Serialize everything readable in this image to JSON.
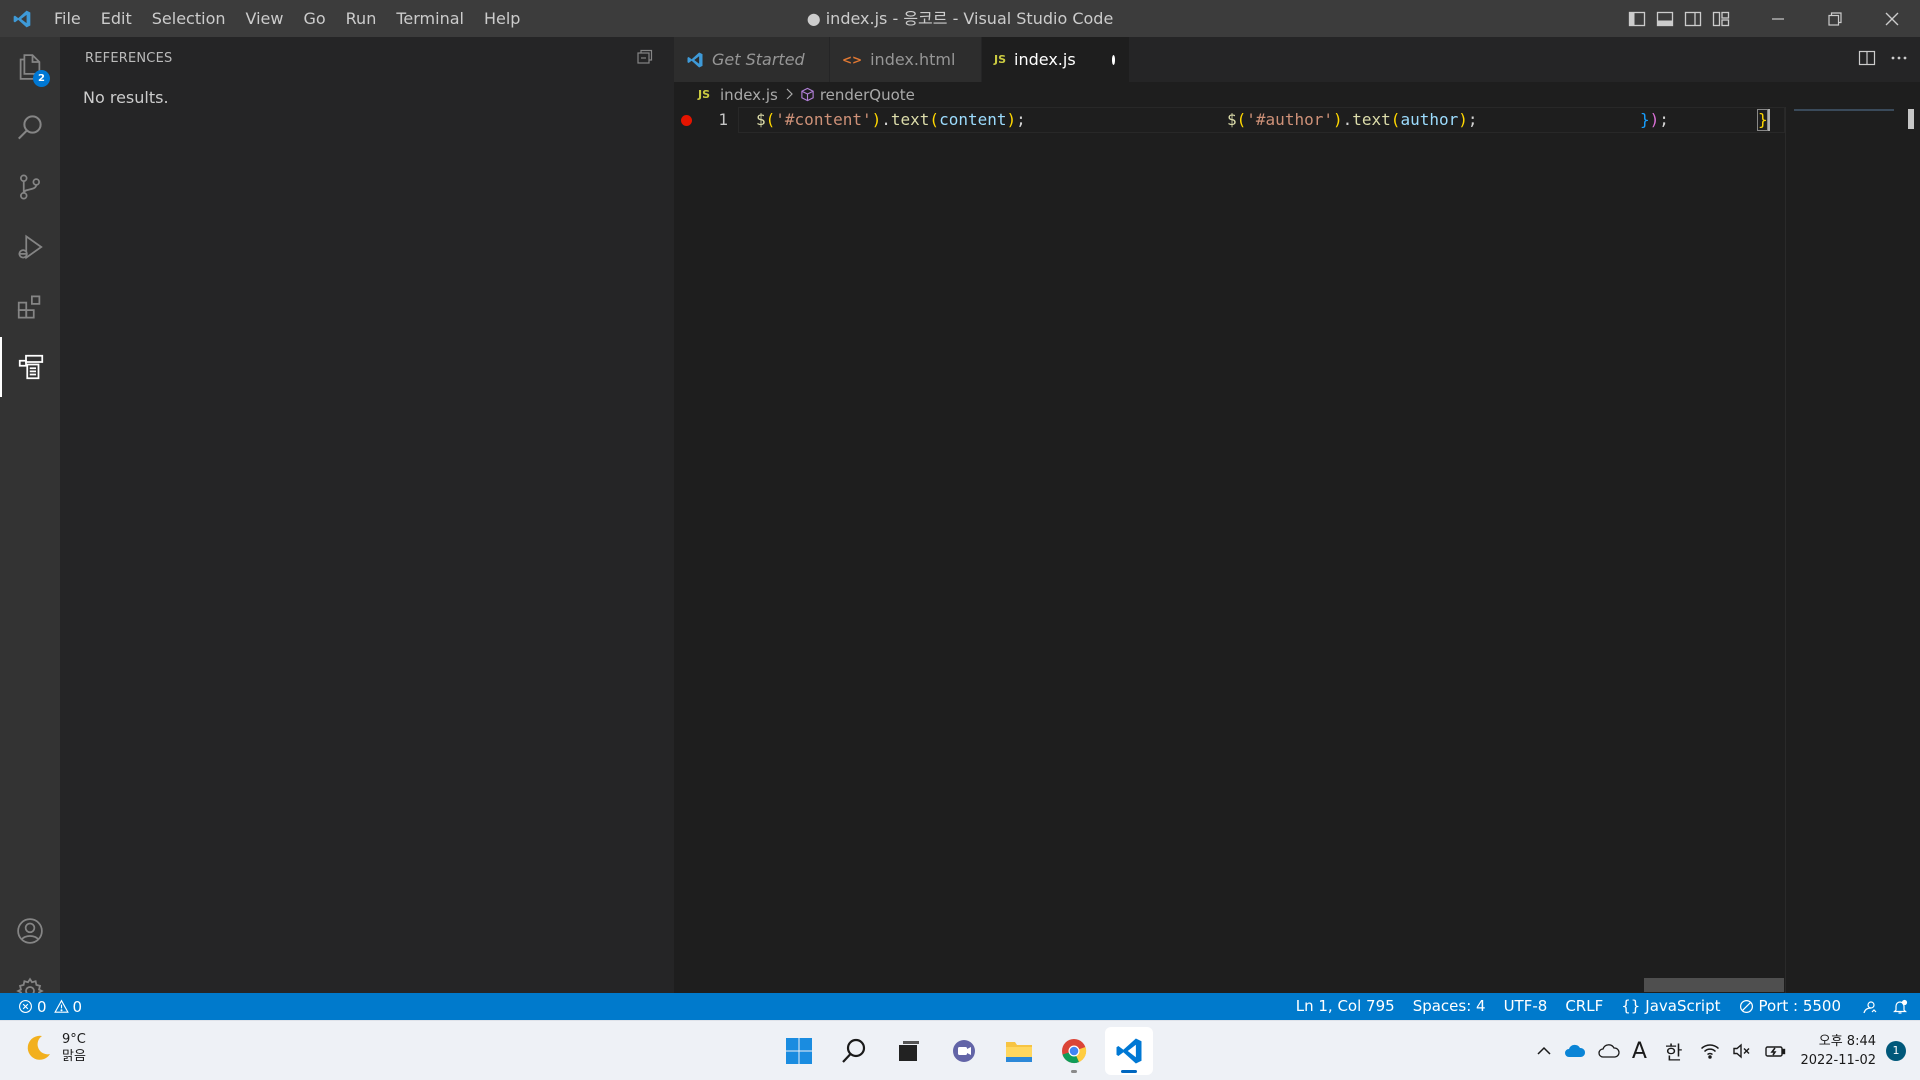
{
  "window": {
    "title": "● index.js - 응코르 - Visual Studio Code"
  },
  "menu": {
    "items": [
      "File",
      "Edit",
      "Selection",
      "View",
      "Go",
      "Run",
      "Terminal",
      "Help"
    ]
  },
  "activity_bar": {
    "explorer_badge": "2"
  },
  "sidebar": {
    "title": "REFERENCES",
    "message": "No results."
  },
  "tabs": [
    {
      "label": "Get Started",
      "icon": "vscode-icon",
      "italic": true,
      "dirty": false
    },
    {
      "label": "index.html",
      "icon": "html-icon",
      "dirty": true
    },
    {
      "label": "index.js",
      "icon": "js-icon",
      "badge": "JS",
      "dirty": true,
      "active": true
    }
  ],
  "breadcrumb": {
    "badge": "JS",
    "file": "index.js",
    "symbol": "renderQuote"
  },
  "editor": {
    "line_number": "1",
    "breakpoint": true,
    "code_line": "$('#content').text(content);            $('#author').text(author);            });  }"
  },
  "statusbar": {
    "errors": "0",
    "warnings": "0",
    "position": "Ln 1, Col 795",
    "spaces": "Spaces: 4",
    "encoding": "UTF-8",
    "eol": "CRLF",
    "language": "JavaScript",
    "port": "Port : 5500"
  },
  "taskbar": {
    "temperature": "9°C",
    "weather": "맑음",
    "ime_lang": "A",
    "ime_mode": "한",
    "time": "오후 8:44",
    "date": "2022-11-02",
    "notifications": "1"
  },
  "colors": {
    "titlebar": "#3c3c3c",
    "activitybar": "#333333",
    "sidebar": "#252526",
    "editor": "#1e1e1e",
    "statusbar": "#007acc",
    "breakpoint": "#e51400"
  }
}
